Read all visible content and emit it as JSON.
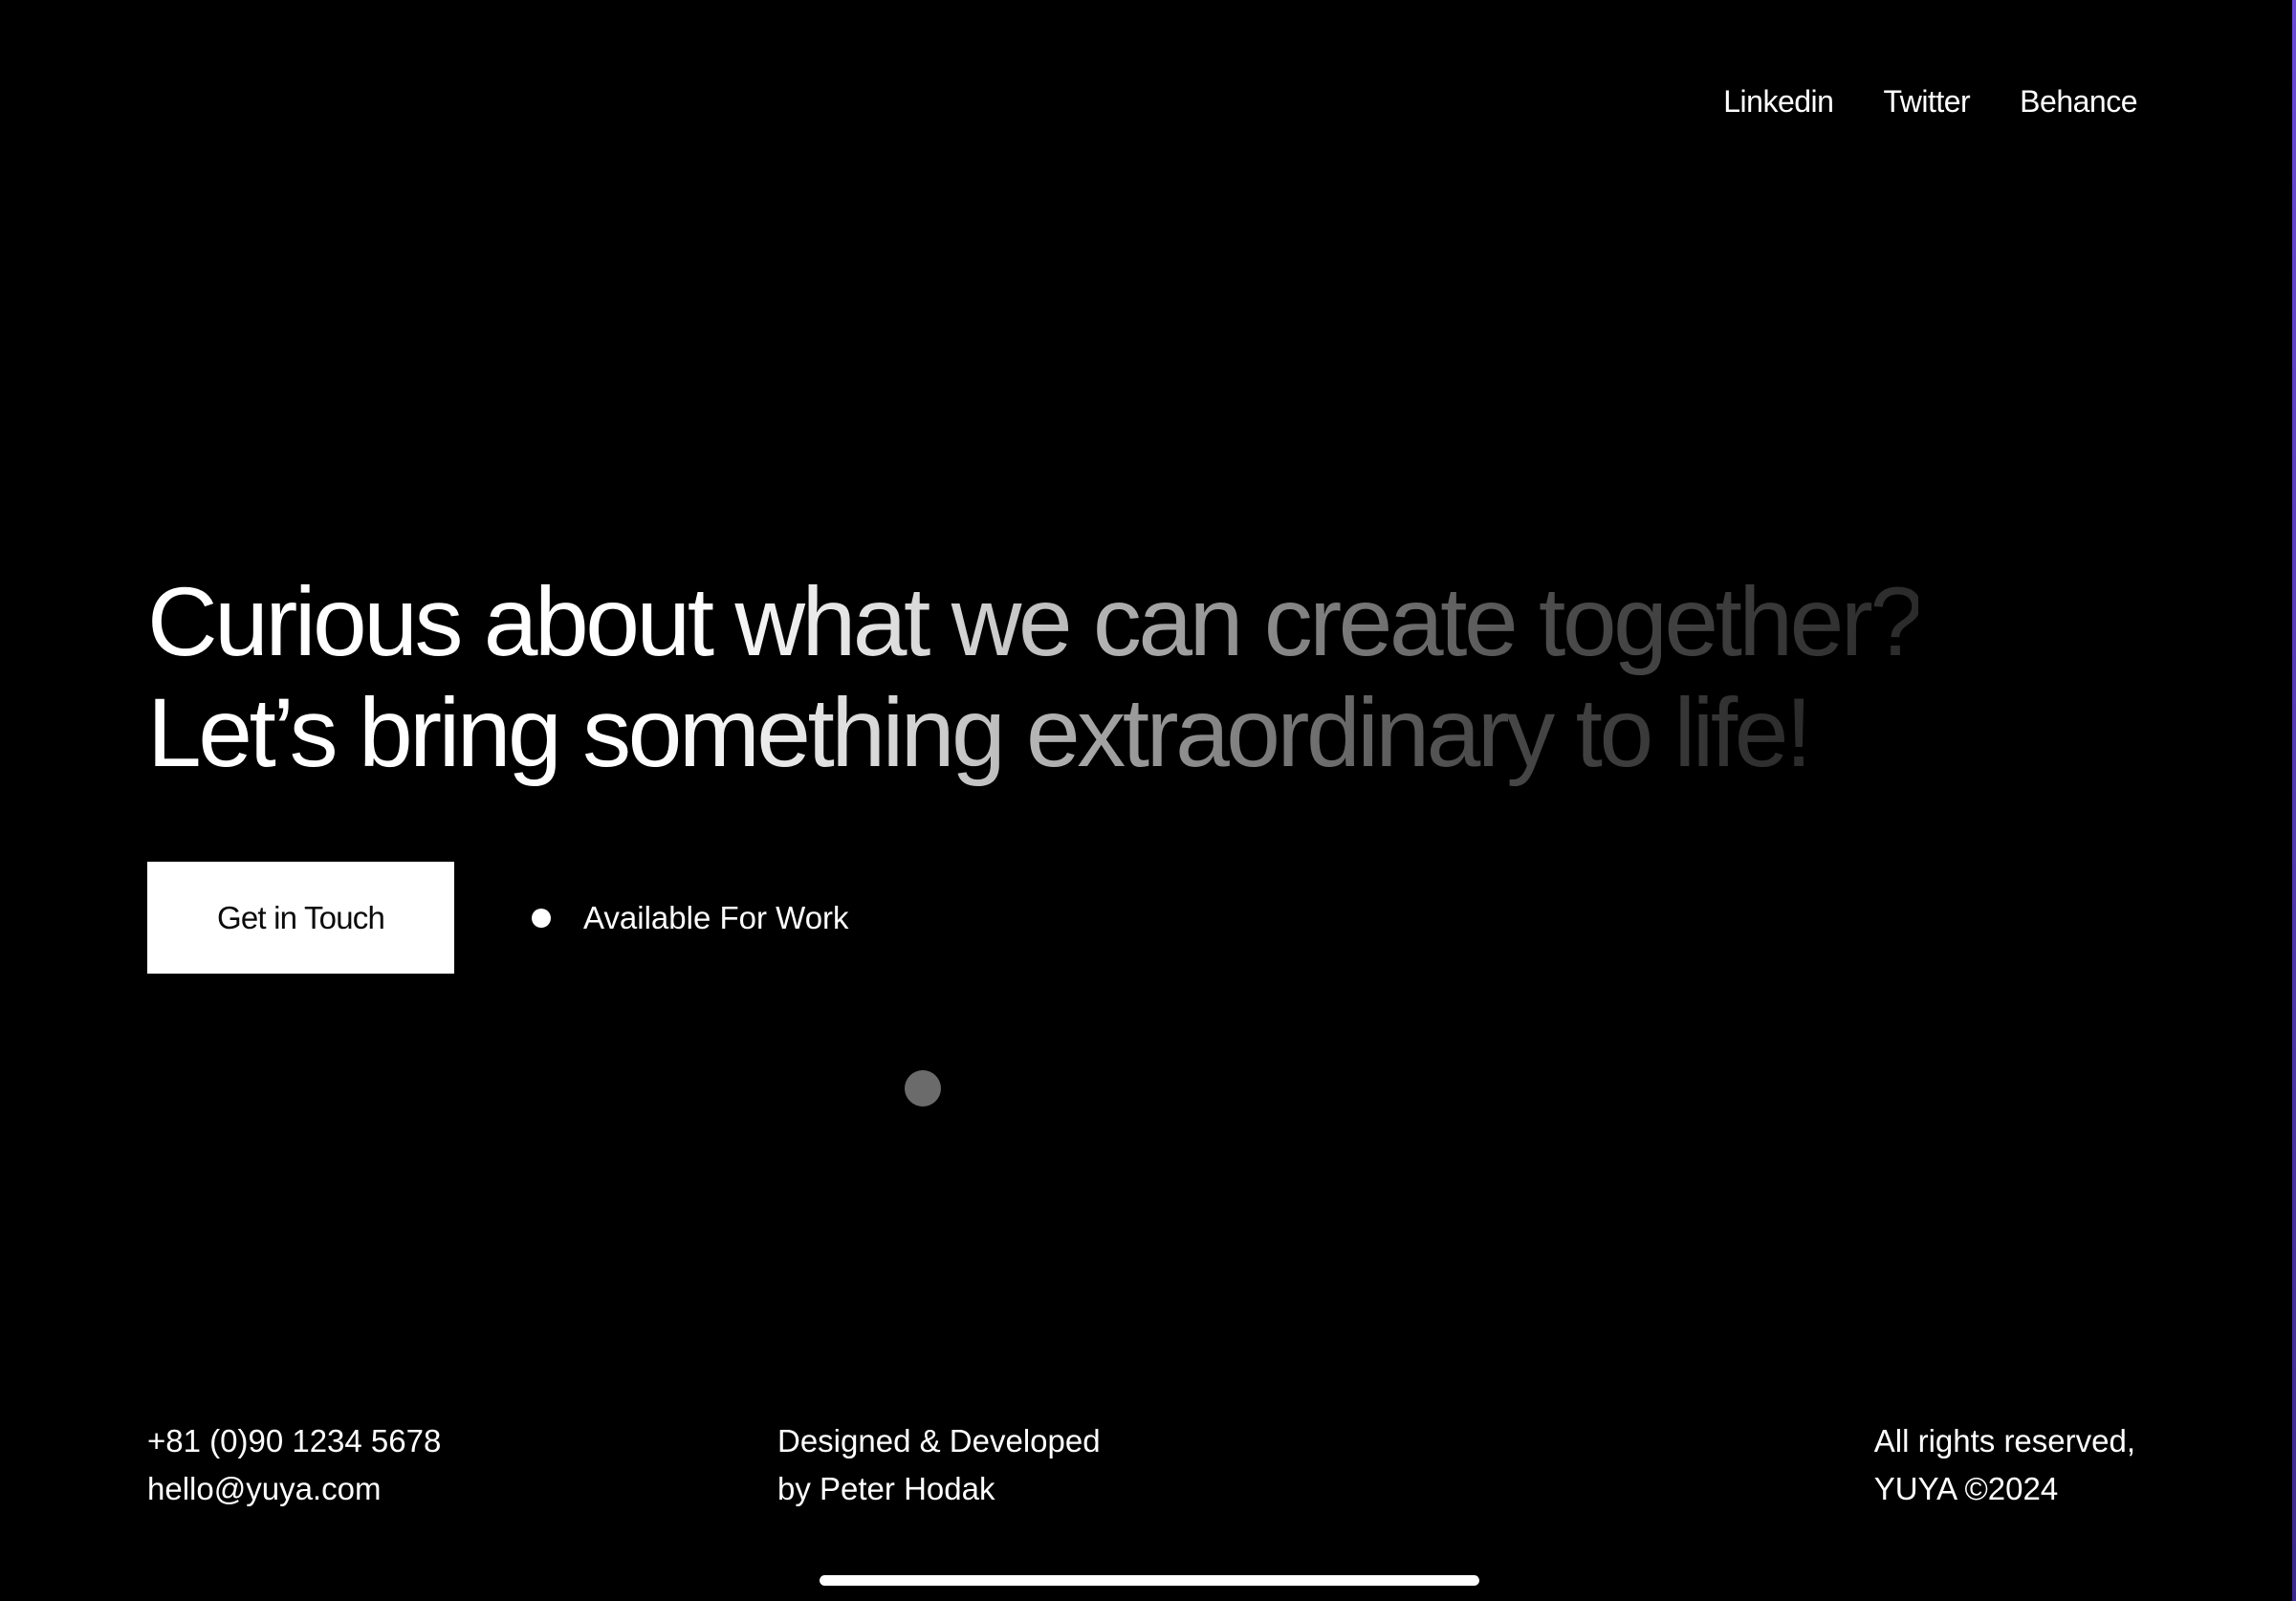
{
  "nav": {
    "links": [
      "Linkedin",
      "Twitter",
      "Behance"
    ]
  },
  "hero": {
    "line1": "Curious about what we can create together?",
    "line2": "Let’s bring something extraordinary to life!"
  },
  "cta": {
    "button_label": "Get in Touch",
    "status_text": "Available For Work"
  },
  "footer": {
    "phone": "+81 (0)90 1234 5678",
    "email": "hello@yuya.com",
    "credit_line1": "Designed & Developed",
    "credit_line2": "by Peter Hodak",
    "rights_line1": "All rights reserved,",
    "rights_line2": "YUYA ©2024"
  },
  "colors": {
    "background": "#000000",
    "text": "#ffffff",
    "button_bg": "#ffffff",
    "button_text": "#0a0a0a",
    "accent_edge": "#6a4bd6"
  }
}
